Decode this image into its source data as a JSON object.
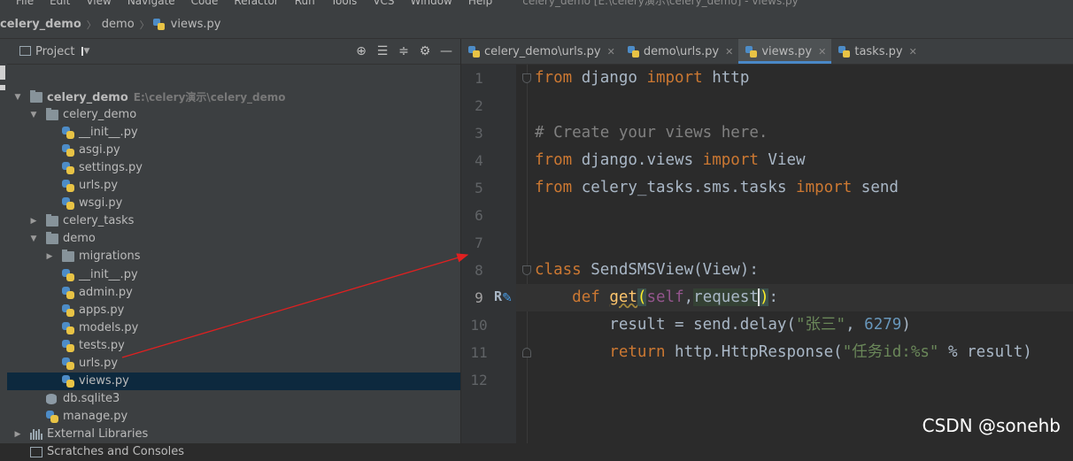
{
  "menubar": {
    "items": [
      "File",
      "Edit",
      "View",
      "Navigate",
      "Code",
      "Refactor",
      "Run",
      "Tools",
      "VCS",
      "Window",
      "Help"
    ],
    "window_title": "celery_demo [E:\\celery演示\\celery_demo] - views.py"
  },
  "navbar": {
    "crumbs": [
      "celery_demo",
      "demo",
      "views.py"
    ]
  },
  "project_panel": {
    "title": "Project",
    "tree": [
      {
        "label": "celery_demo",
        "path": "E:\\celery演示\\celery_demo",
        "type": "folder",
        "level": 0,
        "expanded": true,
        "bold": true
      },
      {
        "label": "celery_demo",
        "type": "folder",
        "level": 1,
        "expanded": true
      },
      {
        "label": "__init__.py",
        "type": "py",
        "level": 2
      },
      {
        "label": "asgi.py",
        "type": "py",
        "level": 2
      },
      {
        "label": "settings.py",
        "type": "py",
        "level": 2
      },
      {
        "label": "urls.py",
        "type": "py",
        "level": 2
      },
      {
        "label": "wsgi.py",
        "type": "py",
        "level": 2
      },
      {
        "label": "celery_tasks",
        "type": "folder",
        "level": 1,
        "expanded": false
      },
      {
        "label": "demo",
        "type": "folder",
        "level": 1,
        "expanded": true
      },
      {
        "label": "migrations",
        "type": "folder",
        "level": 2,
        "expanded": false
      },
      {
        "label": "__init__.py",
        "type": "py",
        "level": 2
      },
      {
        "label": "admin.py",
        "type": "py",
        "level": 2
      },
      {
        "label": "apps.py",
        "type": "py",
        "level": 2
      },
      {
        "label": "models.py",
        "type": "py",
        "level": 2
      },
      {
        "label": "tests.py",
        "type": "py",
        "level": 2
      },
      {
        "label": "urls.py",
        "type": "py",
        "level": 2
      },
      {
        "label": "views.py",
        "type": "py",
        "level": 2,
        "selected": true
      },
      {
        "label": "db.sqlite3",
        "type": "db",
        "level": 1
      },
      {
        "label": "manage.py",
        "type": "py",
        "level": 1
      },
      {
        "label": "External Libraries",
        "type": "lib",
        "level": 0,
        "expanded": false
      },
      {
        "label": "Scratches and Consoles",
        "type": "scratch",
        "level": 0
      }
    ]
  },
  "editor": {
    "tabs": [
      {
        "label": "celery_demo\\urls.py",
        "active": false
      },
      {
        "label": "demo\\urls.py",
        "active": false
      },
      {
        "label": "views.py",
        "active": true
      },
      {
        "label": "tasks.py",
        "active": false
      }
    ],
    "line_numbers": [
      "1",
      "2",
      "3",
      "4",
      "5",
      "6",
      "7",
      "8",
      "9",
      "10",
      "11",
      "12"
    ],
    "current_line": 9,
    "gutter_marker": "R"
  },
  "colors": {
    "keyword": "#cc7832",
    "comment": "#808080",
    "string": "#6a8759",
    "number": "#6897bb",
    "selection": "#0d293e",
    "annotation_arrow": "#e02020"
  },
  "watermark": "CSDN @sonehb"
}
